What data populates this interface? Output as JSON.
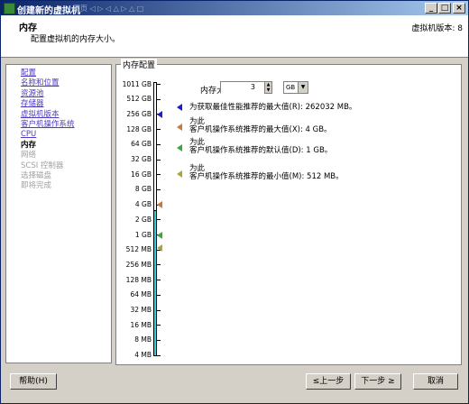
{
  "window": {
    "title": "创建新的虚拟机",
    "toolbar_ghost": "网页  ◁ ▷ ◁ △ ▷ △ □",
    "buttons": {
      "minimize": "_",
      "maximize": "□",
      "close": "×"
    }
  },
  "header": {
    "title": "内存",
    "subtitle": "配置虚拟机的内存大小。",
    "version": "虚拟机版本: 8"
  },
  "nav": {
    "items": [
      {
        "label": "配置",
        "state": "link"
      },
      {
        "label": "名称和位置",
        "state": "link"
      },
      {
        "label": "资源池",
        "state": "link"
      },
      {
        "label": "存储器",
        "state": "link"
      },
      {
        "label": "虚拟机版本",
        "state": "link"
      },
      {
        "label": "客户机操作系统",
        "state": "link"
      },
      {
        "label": "CPU",
        "state": "link"
      },
      {
        "label": "内存",
        "state": "current"
      },
      {
        "label": "网络",
        "state": "disabled"
      },
      {
        "label": "SCSI 控制器",
        "state": "disabled"
      },
      {
        "label": "选择磁盘",
        "state": "disabled"
      },
      {
        "label": "即将完成",
        "state": "disabled"
      }
    ]
  },
  "memory_group": {
    "label": "内存配置",
    "size_label": "内存大小:",
    "size_value": "3",
    "unit": "GB",
    "scale": [
      "1011 GB",
      "512 GB",
      "256 GB",
      "128 GB",
      "64 GB",
      "32 GB",
      "16 GB",
      "8 GB",
      "4 GB",
      "2 GB",
      "1 GB",
      "512 MB",
      "256 MB",
      "128 MB",
      "64 MB",
      "32 MB",
      "16 MB",
      "8 MB",
      "4 MB"
    ],
    "legend": [
      {
        "prefix": "",
        "text": "为获取最佳性能推荐的最大值(R): 262032 MB。",
        "color": "#1c1cc8"
      },
      {
        "prefix": "为此",
        "text": "客户机操作系统推荐的最大值(X): 4 GB。",
        "color": "#c87a3a"
      },
      {
        "prefix": "为此",
        "text": "客户机操作系统推荐的默认值(D): 1 GB。",
        "color": "#3aa83a"
      },
      {
        "prefix": "为此",
        "text": "客户机操作系统推荐的最小值(M): 512 MB。",
        "color": "#a8a83a"
      }
    ]
  },
  "footer": {
    "help": "帮助(H)",
    "back": "≤上一步",
    "next": "下一步 ≥",
    "cancel": "取消"
  }
}
